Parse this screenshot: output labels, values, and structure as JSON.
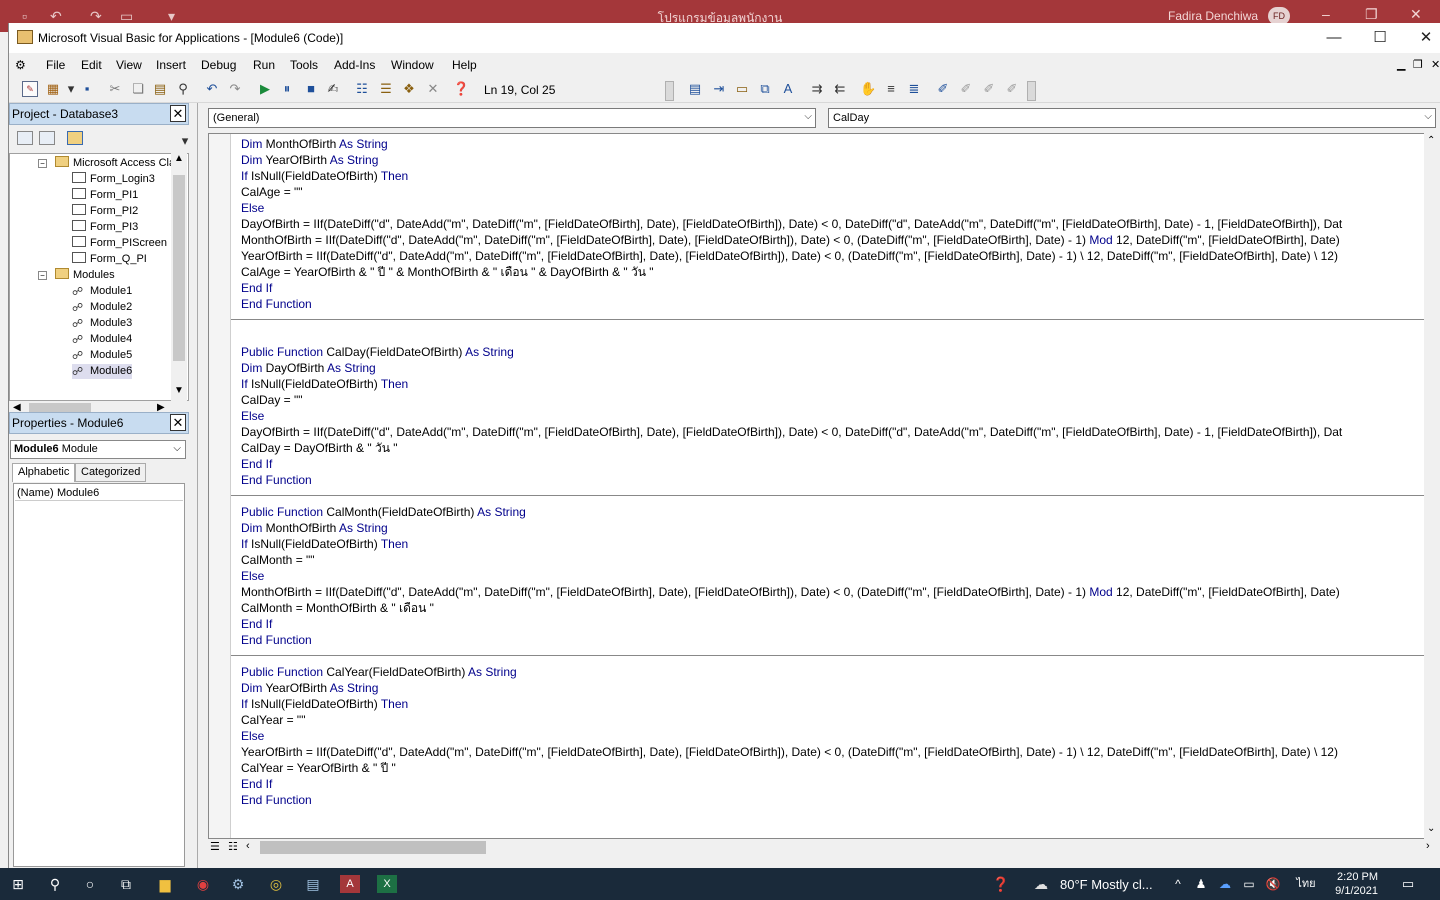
{
  "access": {
    "title": "โปรแกรมข้อมูลพนักงาน",
    "user": "Fadira Denchiwa",
    "avatar": "FD"
  },
  "vba": {
    "title": "Microsoft Visual Basic for Applications - [Module6 (Code)]",
    "menus": [
      "File",
      "Edit",
      "View",
      "Insert",
      "Debug",
      "Run",
      "Tools",
      "Add-Ins",
      "Window",
      "Help"
    ],
    "cursor_position": "Ln 19, Col 25"
  },
  "project": {
    "title": "Project - Database3",
    "root": "Microsoft Access Cla",
    "forms": [
      "Form_Login3",
      "Form_PI1",
      "Form_PI2",
      "Form_PI3",
      "Form_PIScreen",
      "Form_Q_PI"
    ],
    "modules_label": "Modules",
    "modules": [
      "Module1",
      "Module2",
      "Module3",
      "Module4",
      "Module5",
      "Module6"
    ]
  },
  "properties": {
    "title": "Properties - Module6",
    "object_name": "Module6",
    "object_type": "Module",
    "tab_alphabetic": "Alphabetic",
    "tab_categorized": "Categorized",
    "prop_name": "(Name)",
    "prop_value": "Module6"
  },
  "code": {
    "object_combo": "(General)",
    "proc_combo": "CalDay",
    "lines": [
      "Dim MonthOfBirth As String",
      "Dim YearOfBirth As String",
      "If IsNull(FieldDateOfBirth) Then",
      "CalAge = \"\"",
      "Else",
      "DayOfBirth = IIf(DateDiff(\"d\", DateAdd(\"m\", DateDiff(\"m\", [FieldDateOfBirth], Date), [FieldDateOfBirth]), Date) < 0, DateDiff(\"d\", DateAdd(\"m\", DateDiff(\"m\", [FieldDateOfBirth], Date) - 1, [FieldDateOfBirth]), Dat",
      "MonthOfBirth = IIf(DateDiff(\"d\", DateAdd(\"m\", DateDiff(\"m\", [FieldDateOfBirth], Date), [FieldDateOfBirth]), Date) < 0, (DateDiff(\"m\", [FieldDateOfBirth], Date) - 1) Mod 12, DateDiff(\"m\", [FieldDateOfBirth], Date)",
      "YearOfBirth = IIf(DateDiff(\"d\", DateAdd(\"m\", DateDiff(\"m\", [FieldDateOfBirth], Date), [FieldDateOfBirth]), Date) < 0, (DateDiff(\"m\", [FieldDateOfBirth], Date) - 1) \\ 12, DateDiff(\"m\", [FieldDateOfBirth], Date) \\ 12)",
      "CalAge = YearOfBirth & \" ปี \" & MonthOfBirth & \" เดือน \" & DayOfBirth & \" วัน \"",
      "End If",
      "End Function",
      "",
      "",
      "Public Function CalDay(FieldDateOfBirth) As String",
      "Dim DayOfBirth As String",
      "If IsNull(FieldDateOfBirth) Then",
      "CalDay = \"\"",
      "Else",
      "DayOfBirth = IIf(DateDiff(\"d\", DateAdd(\"m\", DateDiff(\"m\", [FieldDateOfBirth], Date), [FieldDateOfBirth]), Date) < 0, DateDiff(\"d\", DateAdd(\"m\", DateDiff(\"m\", [FieldDateOfBirth], Date) - 1, [FieldDateOfBirth]), Dat",
      "CalDay = DayOfBirth & \" วัน \"",
      "End If",
      "End Function",
      "",
      "Public Function CalMonth(FieldDateOfBirth) As String",
      "Dim MonthOfBirth As String",
      "If IsNull(FieldDateOfBirth) Then",
      "CalMonth = \"\"",
      "Else",
      "MonthOfBirth = IIf(DateDiff(\"d\", DateAdd(\"m\", DateDiff(\"m\", [FieldDateOfBirth], Date), [FieldDateOfBirth]), Date) < 0, (DateDiff(\"m\", [FieldDateOfBirth], Date) - 1) Mod 12, DateDiff(\"m\", [FieldDateOfBirth], Date)",
      "CalMonth = MonthOfBirth & \" เดือน \"",
      "End If",
      "End Function",
      "",
      "Public Function CalYear(FieldDateOfBirth) As String",
      "Dim YearOfBirth As String",
      "If IsNull(FieldDateOfBirth) Then",
      "CalYear = \"\"",
      "Else",
      "YearOfBirth = IIf(DateDiff(\"d\", DateAdd(\"m\", DateDiff(\"m\", [FieldDateOfBirth], Date), [FieldDateOfBirth]), Date) < 0, (DateDiff(\"m\", [FieldDateOfBirth], Date) - 1) \\ 12, DateDiff(\"m\", [FieldDateOfBirth], Date) \\ 12)",
      "CalYear = YearOfBirth & \" ปี \"",
      "End If",
      "End Function"
    ]
  },
  "taskbar": {
    "weather": "80°F  Mostly cl...",
    "ime": "ไทย",
    "time": "2:20 PM",
    "date": "9/1/2021"
  },
  "colors": {
    "keyword": "#00008b",
    "access_bar": "#a4373a",
    "taskbar": "#1a2a3a"
  }
}
